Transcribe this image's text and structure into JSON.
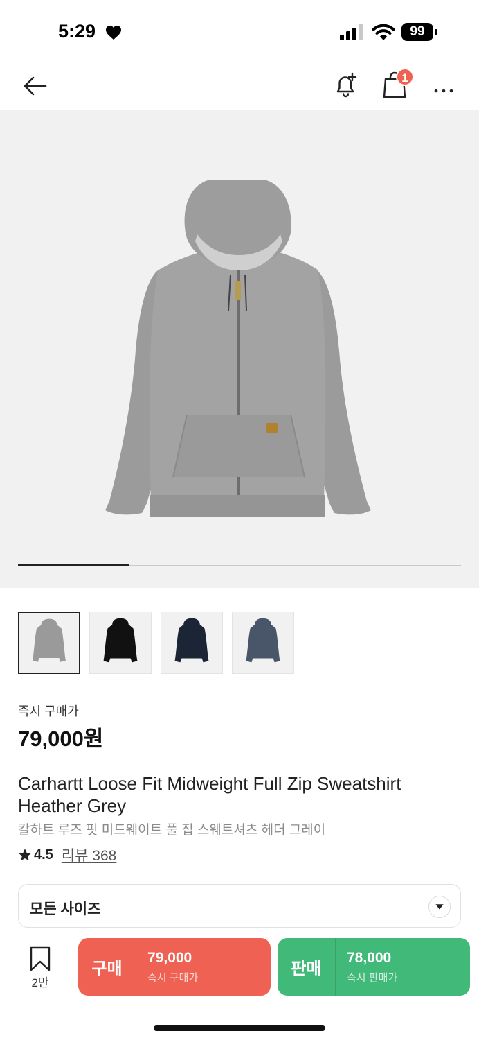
{
  "status_bar": {
    "time": "5:29",
    "battery": "99"
  },
  "nav": {
    "cart_badge": "1",
    "icons": [
      "back-arrow-icon",
      "bell-plus-icon",
      "shopping-bag-icon",
      "more-horizontal-icon"
    ]
  },
  "gallery": {
    "progress": 0.25,
    "thumb_colors": [
      "#9a9a9a",
      "#111111",
      "#1b2535",
      "#495569"
    ]
  },
  "product": {
    "price_label": "즉시 구매가",
    "price": "79,000원",
    "name_en": "Carhartt Loose Fit Midweight Full Zip Sweatshirt Heather Grey",
    "name_ko": "칼하트 루즈 핏 미드웨이트 풀 집 스웨트셔츠 헤더 그레이",
    "rating": "4.5",
    "reviews": "리뷰 368"
  },
  "size_select": {
    "label": "모든 사이즈"
  },
  "bottom_bar": {
    "bookmark_count": "2만",
    "buy": {
      "label": "구매",
      "price": "79,000",
      "sub": "즉시 구매가",
      "color": "#ef6253"
    },
    "sell": {
      "label": "판매",
      "price": "78,000",
      "sub": "즉시 판매가",
      "color": "#41b979"
    }
  }
}
